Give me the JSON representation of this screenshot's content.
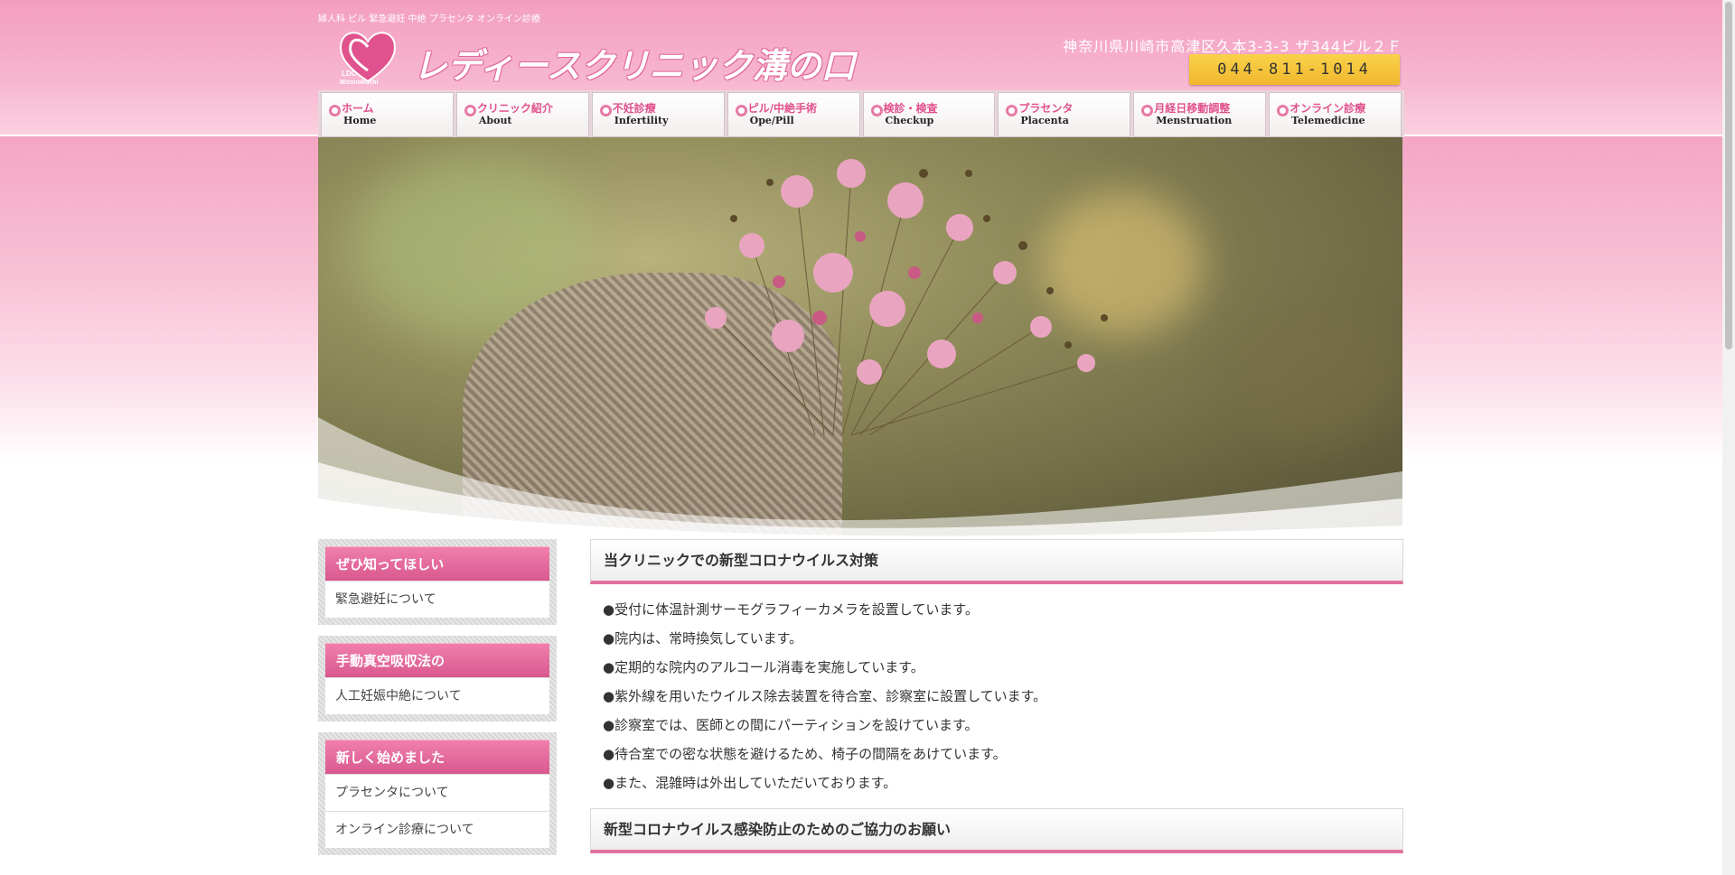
{
  "header": {
    "tagline": "婦人科 ピル 緊急避妊 中絶 プラセンタ オンライン診療",
    "logo_small_1": "LDC",
    "logo_small_2": "Mizonokuchi",
    "logo_text": "レディースクリニック溝の口",
    "address": "神奈川県川崎市高津区久本3-3-3 ザ344ビル２Ｆ",
    "phone": "044-811-1014"
  },
  "nav": [
    {
      "jp": "ホーム",
      "en": "Home"
    },
    {
      "jp": "クリニック紹介",
      "en": "About"
    },
    {
      "jp": "不妊診療",
      "en": "Infertility"
    },
    {
      "jp": "ピル/中絶手術",
      "en": "Ope/Pill"
    },
    {
      "jp": "検診・検査",
      "en": "Checkup"
    },
    {
      "jp": "プラセンタ",
      "en": "Placenta"
    },
    {
      "jp": "月経日移動調整",
      "en": "Menstruation"
    },
    {
      "jp": "オンライン診療",
      "en": "Telemedicine"
    }
  ],
  "sidebar": [
    {
      "title": "ぜひ知ってほしい",
      "items": [
        "緊急避妊について"
      ]
    },
    {
      "title": "手動真空吸収法の",
      "items": [
        "人工妊娠中絶について"
      ]
    },
    {
      "title": "新しく始めました",
      "items": [
        "プラセンタについて",
        "オンライン診療について"
      ]
    }
  ],
  "main": {
    "section1_title": "当クリニックでの新型コロナウイルス対策",
    "bullets": [
      "●受付に体温計測サーモグラフィーカメラを設置しています。",
      "●院内は、常時換気しています。",
      "●定期的な院内のアルコール消毒を実施しています。",
      "●紫外線を用いたウイルス除去装置を待合室、診察室に設置しています。",
      "●診察室では、医師との間にパーティションを設けています。",
      "●待合室での密な状態を避けるため、椅子の間隔をあけています。",
      "●また、混雑時は外出していただいております。"
    ],
    "section2_title": "新型コロナウイルス感染防止のためのご協力のお願い"
  },
  "colors": {
    "accent_pink": "#e0528d",
    "header_pink": "#f39ec0",
    "phone_yellow": "#f1b72d"
  }
}
